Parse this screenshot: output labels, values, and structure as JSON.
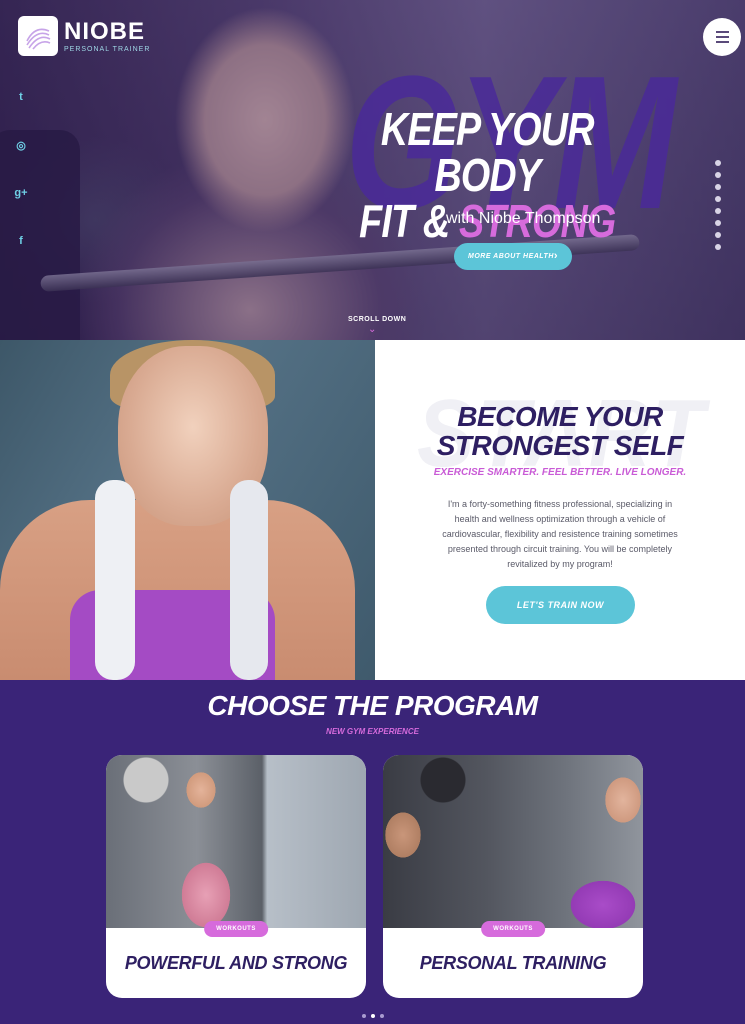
{
  "brand": {
    "name": "NIOBE",
    "subtitle": "PERSONAL TRAINER"
  },
  "hero": {
    "watermark": "GYM",
    "title_line1": "KEEP YOUR BODY",
    "title_line2_a": "FIT & ",
    "title_line2_b": "STRONG",
    "with": "with Niobe Thompson",
    "cta": "MORE ABOUT HEALTH",
    "scroll": "SCROLL DOWN"
  },
  "social": [
    {
      "icon": "twitter-icon",
      "glyph": "t"
    },
    {
      "icon": "instagram-icon",
      "glyph": "◎"
    },
    {
      "icon": "google-plus-icon",
      "glyph": "g+"
    },
    {
      "icon": "facebook-icon",
      "glyph": "f"
    }
  ],
  "about": {
    "watermark": "START",
    "title_line1": "BECOME YOUR",
    "title_line2": "STRONGEST SELF",
    "subtitle": "EXERCISE SMARTER. FEEL BETTER. LIVE LONGER.",
    "body": "I'm a forty-something fitness professional, specializing in health and wellness optimization through a vehicle of cardiovascular, flexibility and resistence training sometimes presented through circuit training. You will be completely revitalized by my program!",
    "cta": "LET'S TRAIN NOW"
  },
  "program": {
    "title": "CHOOSE THE PROGRAM",
    "subtitle": "NEW GYM EXPERIENCE",
    "cards": [
      {
        "tag": "WORKOUTS",
        "title": "POWERFUL AND STRONG"
      },
      {
        "tag": "WORKOUTS",
        "title": "PERSONAL TRAINING"
      }
    ]
  },
  "colors": {
    "accent_purple": "#d66bdc",
    "accent_cyan": "#5cc5d8",
    "navy": "#3a2478"
  }
}
